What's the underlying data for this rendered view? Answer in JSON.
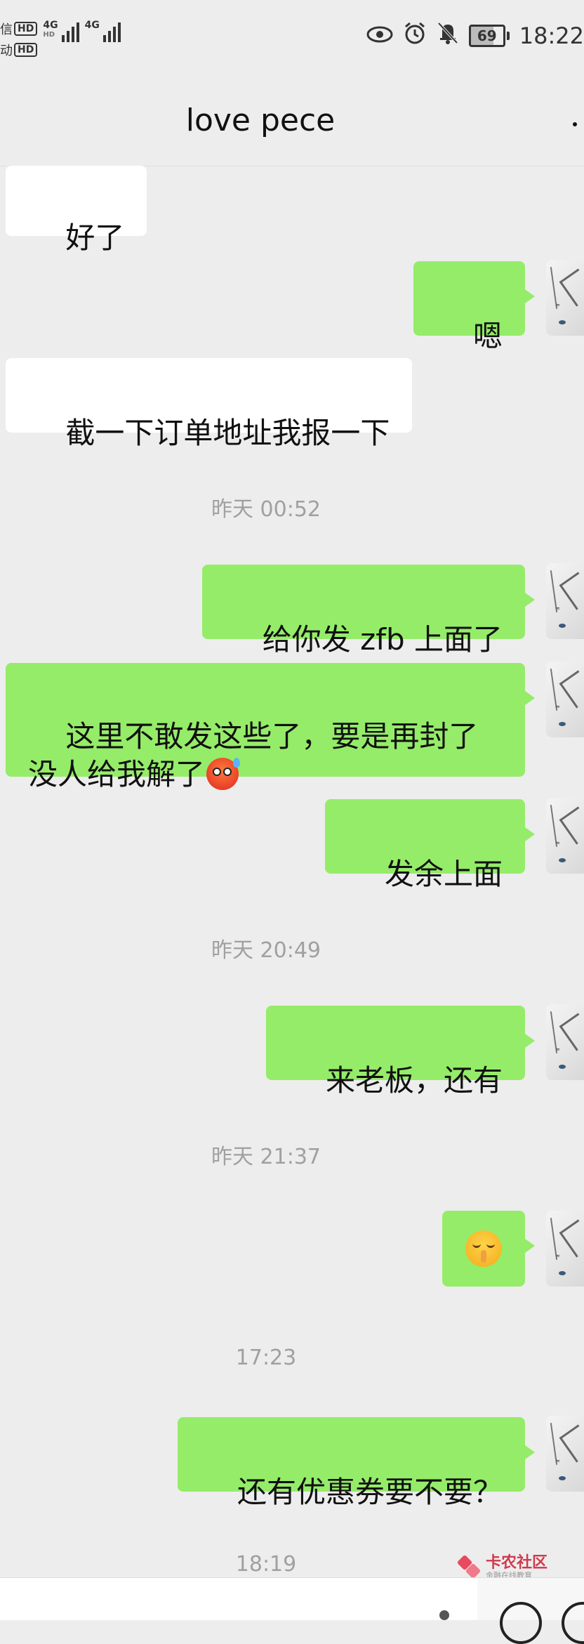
{
  "status_bar": {
    "sim1_label": "信",
    "sim2_label": "动",
    "hd_label": "HD",
    "net1": "4G",
    "net1_sub": "HD",
    "net2": "4G",
    "battery_level": "69",
    "battery_fraction": 0.69,
    "time": "18:22",
    "icons": [
      "eye-icon",
      "alarm-icon",
      "mute-bell-icon",
      "battery-icon"
    ]
  },
  "header": {
    "title": "love pece",
    "more_icon": "more-dots-icon"
  },
  "messages": [
    {
      "side": "left",
      "text": "好了"
    },
    {
      "side": "right",
      "text": "嗯"
    },
    {
      "side": "left",
      "text": "截一下订单地址我报一下"
    },
    {
      "type": "time",
      "text": "昨天 00:52"
    },
    {
      "side": "right",
      "text": "给你发 zfb 上面了"
    },
    {
      "side": "right",
      "text": "这里不敢发这些了，要是再封了没人给我解了",
      "emoji": "hot-face-sweat-emoji"
    },
    {
      "side": "right",
      "text": "发余上面"
    },
    {
      "type": "time",
      "text": "昨天 20:49"
    },
    {
      "side": "right",
      "text": "来老板，还有"
    },
    {
      "type": "time",
      "text": "昨天 21:37"
    },
    {
      "side": "right",
      "emoji": "shushing-face-emoji"
    },
    {
      "type": "time",
      "text": "17:23"
    },
    {
      "side": "right",
      "text": "还有优惠券要不要？"
    },
    {
      "type": "time",
      "text": "18:19"
    }
  ],
  "watermark": {
    "title": "卡农社区",
    "subtitle": "金融在线教育"
  },
  "colors": {
    "background": "#ededed",
    "bubble_right": "#95ec69",
    "bubble_left": "#ffffff",
    "timestamp": "#a0a0a0"
  }
}
